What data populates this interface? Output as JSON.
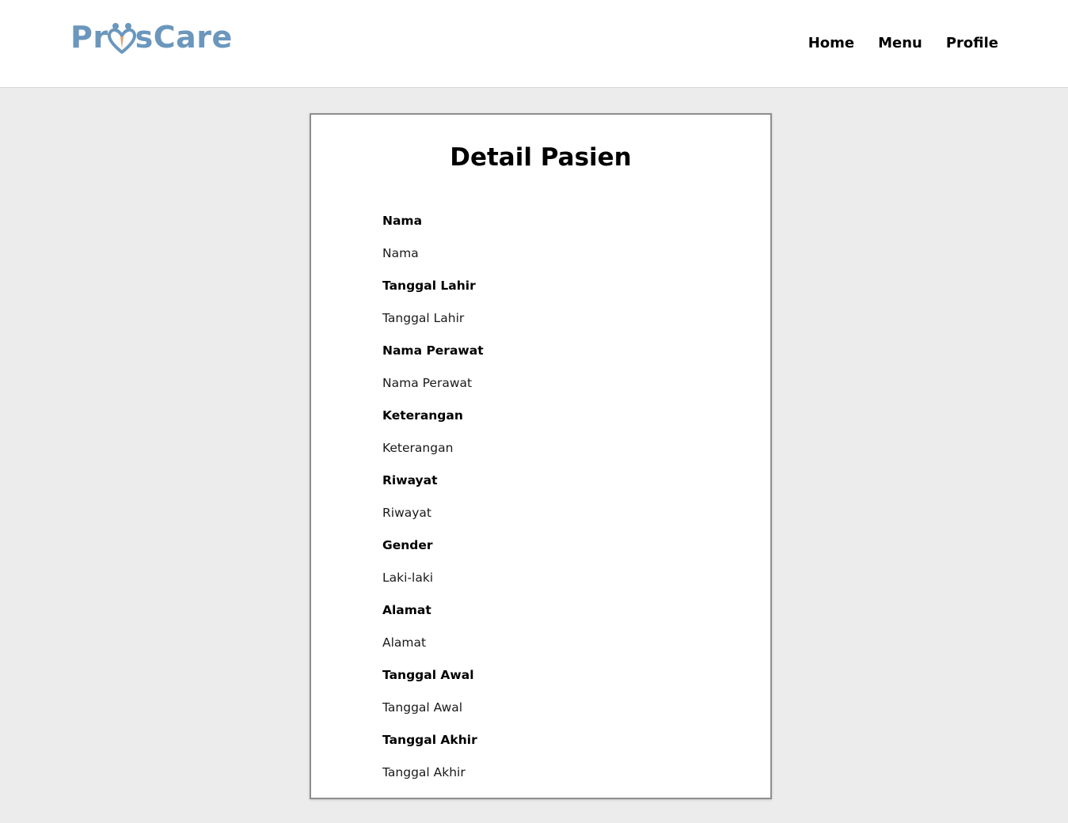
{
  "brand": {
    "text_before": "Pr",
    "text_after": "sCare",
    "colors": {
      "primary": "#6b97bd",
      "accent": "#e0a06b"
    }
  },
  "nav": {
    "items": [
      {
        "label": "Home"
      },
      {
        "label": "Menu"
      },
      {
        "label": "Profile"
      }
    ]
  },
  "detail": {
    "title": "Detail Pasien",
    "fields": [
      {
        "label": "Nama",
        "value": "Nama"
      },
      {
        "label": "Tanggal Lahir",
        "value": "Tanggal Lahir"
      },
      {
        "label": "Nama Perawat",
        "value": "Nama Perawat"
      },
      {
        "label": "Keterangan",
        "value": "Keterangan"
      },
      {
        "label": "Riwayat",
        "value": "Riwayat"
      },
      {
        "label": "Gender",
        "value": "Laki-laki"
      },
      {
        "label": "Alamat",
        "value": "Alamat"
      },
      {
        "label": "Tanggal Awal",
        "value": "Tanggal Awal"
      },
      {
        "label": "Tanggal Akhir",
        "value": "Tanggal Akhir"
      }
    ]
  },
  "colors": {
    "page_background": "#ececec",
    "card_border": "#8e8e8e",
    "text": "#000000"
  }
}
